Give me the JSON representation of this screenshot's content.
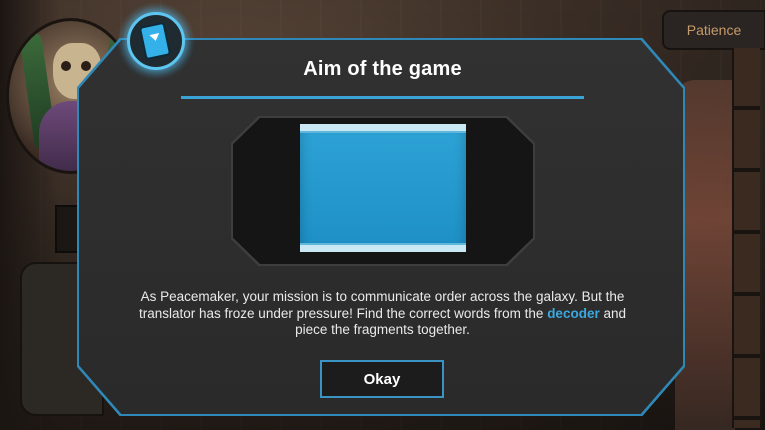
{
  "hud": {
    "patience_label": "Patience"
  },
  "dialog": {
    "title": "Aim of the game",
    "body_before": "As Peacemaker, your mission is to communicate order across the galaxy. But the translator has froze under pressure! Find the correct words from the ",
    "body_keyword": "decoder",
    "body_after": " and piece the fragments together.",
    "okay_label": "Okay"
  },
  "icons": {
    "badge": "card-icon"
  },
  "colors": {
    "accent": "#3ba8e0",
    "panel": "#2d2d2d",
    "screen": "#2ea3d6",
    "patience_text": "#c79a6a"
  }
}
